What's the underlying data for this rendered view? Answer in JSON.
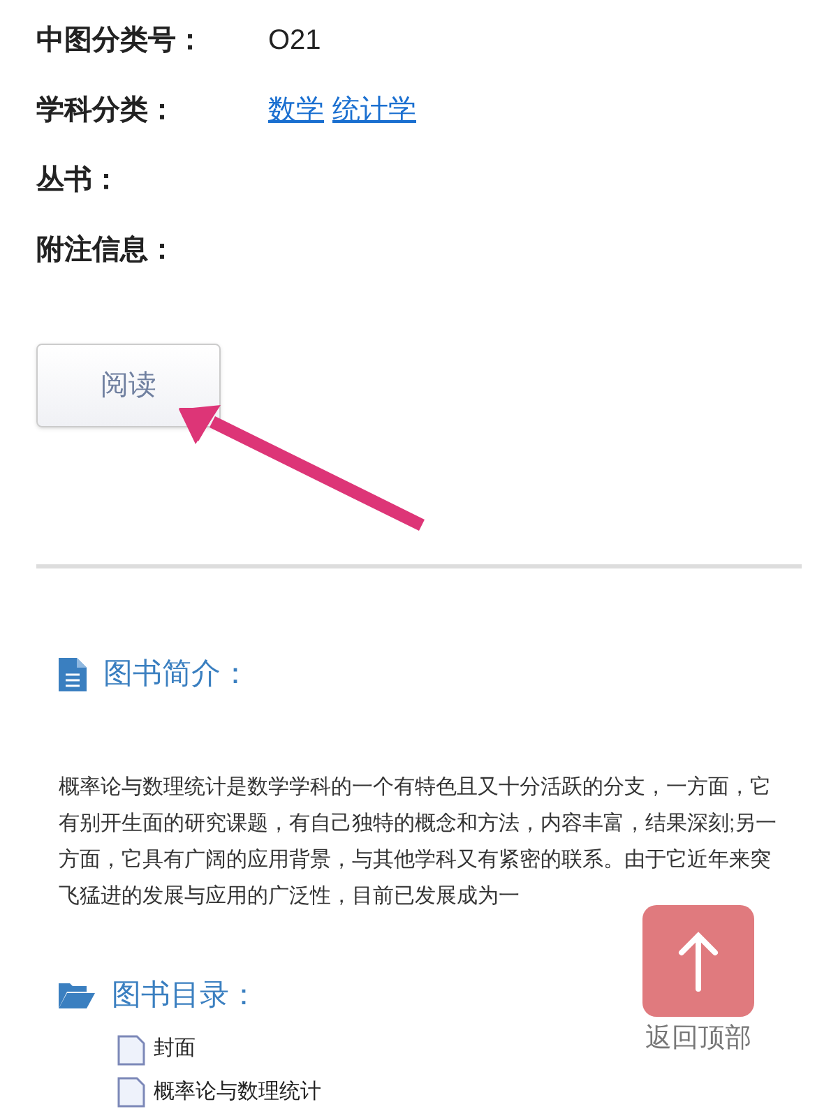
{
  "fields": [
    {
      "label": "中图分类号：",
      "value": "O21"
    },
    {
      "label": "学科分类：",
      "links": [
        "数学",
        "统计学"
      ]
    },
    {
      "label": "丛书："
    },
    {
      "label": "附注信息："
    }
  ],
  "read_button": "阅读",
  "intro": {
    "title": "图书简介：",
    "text": "概率论与数理统计是数学学科的一个有特色且又十分活跃的分支，一方面，它有别开生面的研究课题，有自己独特的概念和方法，内容丰富，结果深刻;另一方面，它具有广阔的应用背景，与其他学科又有紧密的联系。由于它近年来突飞猛进的发展与应用的广泛性，目前已发展成为一"
  },
  "toc": {
    "title": "图书目录：",
    "items": [
      "封面",
      "概率论与数理统计"
    ]
  },
  "back_to_top": "返回顶部"
}
